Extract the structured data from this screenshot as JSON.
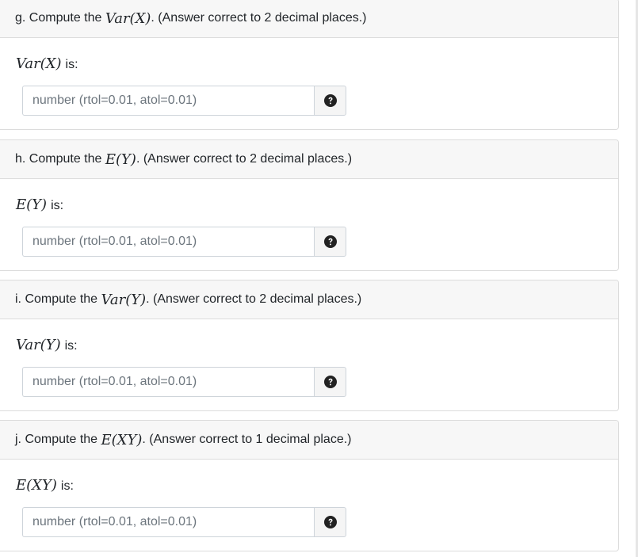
{
  "questions": [
    {
      "header_prefix": "g. Compute the",
      "header_math": "Var(X)",
      "header_suffix": ". (Answer correct to 2 decimal places.)",
      "prompt_math": "Var(X)",
      "prompt_suffix": "is:",
      "placeholder": "number (rtol=0.01, atol=0.01)",
      "value": ""
    },
    {
      "header_prefix": "h. Compute the",
      "header_math": "E(Y)",
      "header_suffix": ". (Answer correct to 2 decimal places.)",
      "prompt_math": "E(Y)",
      "prompt_suffix": "is:",
      "placeholder": "number (rtol=0.01, atol=0.01)",
      "value": ""
    },
    {
      "header_prefix": "i. Compute the",
      "header_math": "Var(Y)",
      "header_suffix": ". (Answer correct to 2 decimal places.)",
      "prompt_math": "Var(Y)",
      "prompt_suffix": "is:",
      "placeholder": "number (rtol=0.01, atol=0.01)",
      "value": ""
    },
    {
      "header_prefix": "j. Compute the",
      "header_math": "E(XY)",
      "header_suffix": ". (Answer correct to 1 decimal place.)",
      "prompt_math": "E(XY)",
      "prompt_suffix": "is:",
      "placeholder": "number (rtol=0.01, atol=0.01)",
      "value": ""
    }
  ],
  "icons": {
    "help": "question-circle-icon"
  },
  "colors": {
    "header_bg": "#f7f7f7",
    "border": "#dcdcdc",
    "addon_bg": "#f5f5f5",
    "icon": "#222222"
  }
}
